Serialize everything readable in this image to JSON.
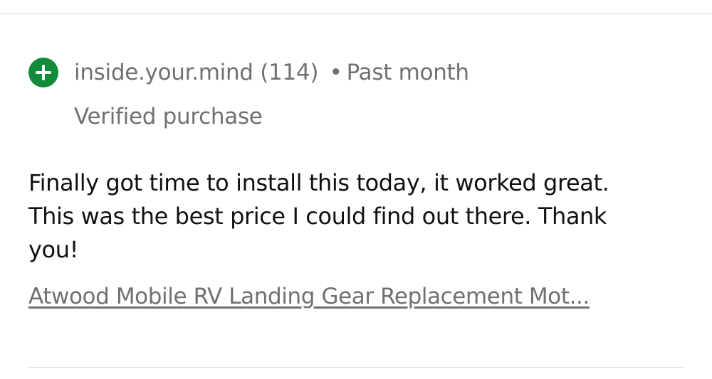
{
  "review": {
    "reviewer_name": "inside.your.mind",
    "reviewer_score": "(114)",
    "separator": "•",
    "time_ago": "Past month",
    "verified_label": "Verified purchase",
    "body": "Finally got time to install this today, it worked great. This was the best price I could find out there. Thank you!",
    "product_link": "Atwood Mobile RV Landing Gear Replacement Mot...",
    "rating_icon": "plus-icon",
    "rating_color": "#118a3a"
  }
}
